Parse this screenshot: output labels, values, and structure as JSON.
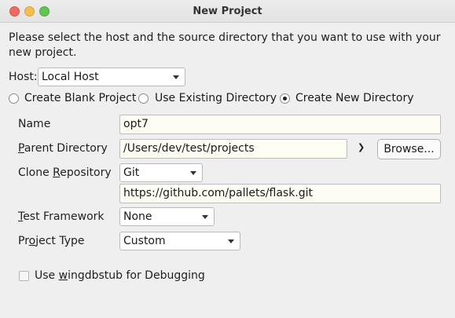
{
  "window": {
    "title": "New Project"
  },
  "intro": "Please select the host and the source directory that you want to use with your new project.",
  "host": {
    "label": "Host:",
    "value": "Local Host"
  },
  "mode_options": [
    {
      "label": "Create Blank Project",
      "selected": false
    },
    {
      "label": "Use Existing Directory",
      "selected": false
    },
    {
      "label": "Create New Directory",
      "selected": true
    }
  ],
  "form": {
    "name": {
      "label": "Name",
      "value": "opt7"
    },
    "parent_directory": {
      "label": "Parent Directory",
      "value": "/Users/dev/test/projects",
      "browse_label": "Browse..."
    },
    "clone_repository": {
      "label": "Clone Repository",
      "vcs": "Git",
      "url": "https://github.com/pallets/flask.git"
    },
    "test_framework": {
      "label": "Test Framework",
      "value": "None"
    },
    "project_type": {
      "label": "Project Type",
      "value": "Custom"
    }
  },
  "wingdbstub": {
    "label": "Use wingdbstub for Debugging",
    "checked": false
  },
  "colors": {
    "field_background": "#fefdf4",
    "close": "#ee6a5e",
    "minimize": "#f5be4f",
    "maximize": "#61c454"
  }
}
